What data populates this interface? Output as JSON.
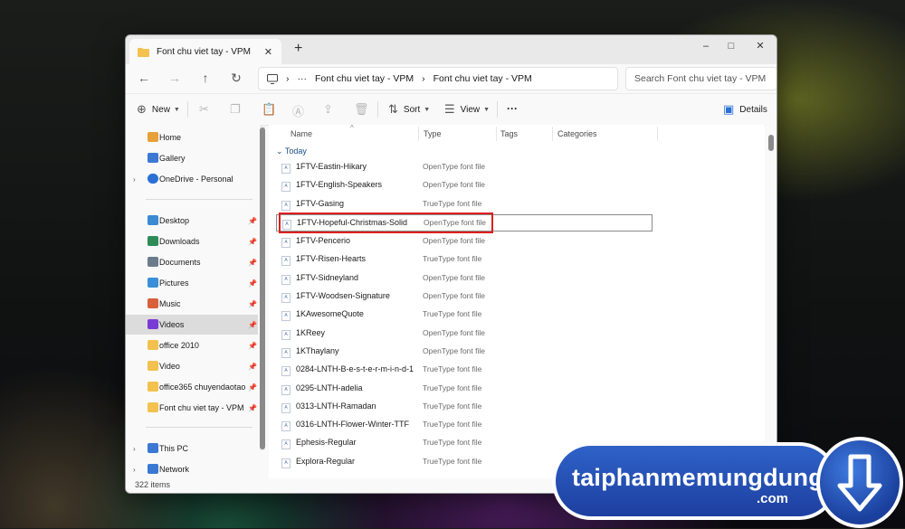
{
  "window": {
    "tab_title": "Font chu viet tay - VPM",
    "tab_close": "✕",
    "new_tab": "+",
    "minimize": "–",
    "maximize": "□",
    "close": "✕"
  },
  "address": {
    "crumbs": [
      "Font chu viet tay - VPM",
      "Font chu viet tay - VPM"
    ],
    "ellipsis": "···",
    "separator": "›",
    "search_placeholder": "Search Font chu viet tay - VPM"
  },
  "toolbar": {
    "new_label": "New",
    "sort_label": "Sort",
    "view_label": "View",
    "more_label": "···",
    "details_label": "Details"
  },
  "sidebar": {
    "items": [
      {
        "label": "Home",
        "icon": "home-icon",
        "color": "#e8a03a"
      },
      {
        "label": "Gallery",
        "icon": "gallery-icon",
        "color": "#3a78d4"
      },
      {
        "label": "OneDrive - Personal",
        "icon": "cloud-icon",
        "color": "#2a6fd6"
      },
      {
        "label": "Desktop",
        "icon": "desktop-icon",
        "color": "#3a8ad4"
      },
      {
        "label": "Downloads",
        "icon": "download-icon",
        "color": "#2e8b57"
      },
      {
        "label": "Documents",
        "icon": "document-icon",
        "color": "#6b7b8c"
      },
      {
        "label": "Pictures",
        "icon": "pictures-icon",
        "color": "#3a90d8"
      },
      {
        "label": "Music",
        "icon": "music-icon",
        "color": "#d8603a"
      },
      {
        "label": "Videos",
        "icon": "videos-icon",
        "color": "#7a3ad4"
      },
      {
        "label": "office 2010",
        "icon": "folder-icon",
        "color": "#f2c14e"
      },
      {
        "label": "Video",
        "icon": "folder-icon",
        "color": "#f2c14e"
      },
      {
        "label": "office365 chuyendaotao",
        "icon": "folder-icon",
        "color": "#f2c14e"
      },
      {
        "label": "Font chu viet tay - VPM",
        "icon": "folder-icon",
        "color": "#f2c14e"
      },
      {
        "label": "This PC",
        "icon": "computer-icon",
        "color": "#3a78d4"
      },
      {
        "label": "Network",
        "icon": "network-icon",
        "color": "#3a78d4"
      }
    ]
  },
  "columns": {
    "name": "Name",
    "type": "Type",
    "tags": "Tags",
    "categories": "Categories"
  },
  "group_label": "Today",
  "files": [
    {
      "name": "1FTV-Eastin-Hikary",
      "type": "OpenType font file"
    },
    {
      "name": "1FTV-English-Speakers",
      "type": "OpenType font file"
    },
    {
      "name": "1FTV-Gasing",
      "type": "TrueType font file"
    },
    {
      "name": "1FTV-Hopeful-Christmas-Solid",
      "type": "OpenType font file"
    },
    {
      "name": "1FTV-Pencerio",
      "type": "OpenType font file"
    },
    {
      "name": "1FTV-Risen-Hearts",
      "type": "TrueType font file"
    },
    {
      "name": "1FTV-Sidneyland",
      "type": "OpenType font file"
    },
    {
      "name": "1FTV-Woodsen-Signature",
      "type": "OpenType font file"
    },
    {
      "name": "1KAwesomeQuote",
      "type": "TrueType font file"
    },
    {
      "name": "1KReey",
      "type": "OpenType font file"
    },
    {
      "name": "1KThaylany",
      "type": "OpenType font file"
    },
    {
      "name": "0284-LNTH-B-e-s-t-e-r-m-i-n-d-1",
      "type": "TrueType font file"
    },
    {
      "name": "0295-LNTH-adelia",
      "type": "TrueType font file"
    },
    {
      "name": "0313-LNTH-Ramadan",
      "type": "TrueType font file"
    },
    {
      "name": "0316-LNTH-Flower-Winter-TTF",
      "type": "TrueType font file"
    },
    {
      "name": "Ephesis-Regular",
      "type": "TrueType font file"
    },
    {
      "name": "Explora-Regular",
      "type": "TrueType font file"
    }
  ],
  "status": {
    "count": "322 items"
  },
  "watermark": {
    "main": "taiphanmemungdung",
    "sub": ".com"
  }
}
